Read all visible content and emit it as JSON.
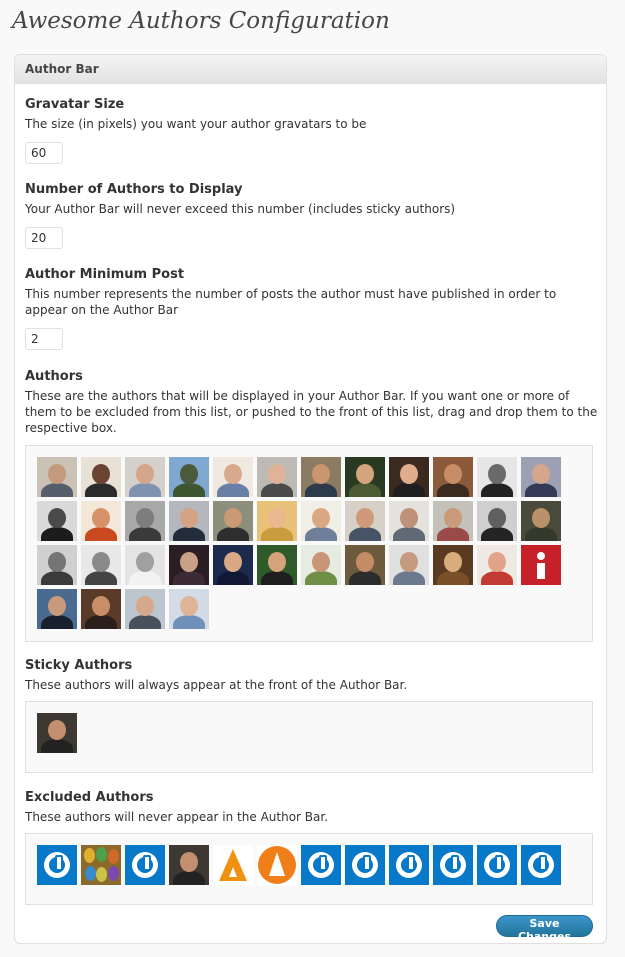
{
  "page": {
    "title": "Awesome Authors Configuration"
  },
  "section": {
    "header": "Author Bar"
  },
  "gravatar": {
    "title": "Gravatar Size",
    "description": "The size (in pixels) you want your author gravatars to be",
    "value": "60"
  },
  "num_authors": {
    "title": "Number of Authors to Display",
    "description": "Your Author Bar will never exceed this number (includes sticky authors)",
    "value": "20"
  },
  "min_post": {
    "title": "Author Minimum Post",
    "description": "This number represents the number of posts the author must have published in order to appear on the Author Bar",
    "value": "2"
  },
  "authors": {
    "title": "Authors",
    "description": "These are the authors that will be displayed in your Author Bar. If you want one or more of them to be excluded from this list, or pushed to the front of this list, drag and drop them to the respective box.",
    "avatars": [
      {
        "bg": "#c9c2b5",
        "skin": "#c49a7c",
        "shirt": "#555e6a"
      },
      {
        "bg": "#e7e1d6",
        "skin": "#6b4332",
        "shirt": "#2b2b2b"
      },
      {
        "bg": "#d4d0cb",
        "skin": "#d4a58a",
        "shirt": "#7f93b0"
      },
      {
        "bg": "#7fa7cf",
        "skin": "#4c5a3c",
        "shirt": "#3f5731"
      },
      {
        "bg": "#efe9e1",
        "skin": "#d8a98c",
        "shirt": "#6a7fa6"
      },
      {
        "bg": "#bdbab5",
        "skin": "#e0b29a",
        "shirt": "#4b4b4b"
      },
      {
        "bg": "#8c7b63",
        "skin": "#c9966f",
        "shirt": "#2c3a4b"
      },
      {
        "bg": "#2a3a22",
        "skin": "#d3a47e",
        "shirt": "#4c5b34"
      },
      {
        "bg": "#3b2a20",
        "skin": "#e0ad8c",
        "shirt": "#1f1f1f"
      },
      {
        "bg": "#8a5a3a",
        "skin": "#c88d67",
        "shirt": "#3a2a1f"
      },
      {
        "bg": "#e6e6e6",
        "skin": "#6a6a6a",
        "shirt": "#222222"
      },
      {
        "bg": "#9d9fb3",
        "skin": "#d4a68c",
        "shirt": "#333a55"
      },
      {
        "bg": "#d9d9d9",
        "skin": "#4a4a4a",
        "shirt": "#1c1c1c"
      },
      {
        "bg": "#f3e8d8",
        "skin": "#d89269",
        "shirt": "#c84a1e"
      },
      {
        "bg": "#a8a8a8",
        "skin": "#7d7d7d",
        "shirt": "#3a3a3a"
      },
      {
        "bg": "#b4b8bd",
        "skin": "#d3a383",
        "shirt": "#232c3a"
      },
      {
        "bg": "#8c8f7c",
        "skin": "#c99a73",
        "shirt": "#2e2e2e"
      },
      {
        "bg": "#e9c27a",
        "skin": "#eab78f",
        "shirt": "#c99c3e"
      },
      {
        "bg": "#f1eee6",
        "skin": "#d9a782",
        "shirt": "#6f7f99"
      },
      {
        "bg": "#d6d0c6",
        "skin": "#cf9a7a",
        "shirt": "#485465"
      },
      {
        "bg": "#e5e2de",
        "skin": "#c09179",
        "shirt": "#5f6a74"
      },
      {
        "bg": "#c4c1bb",
        "skin": "#c99b7b",
        "shirt": "#9b4a4a"
      },
      {
        "bg": "#cfcfcf",
        "skin": "#5f5f5f",
        "shirt": "#242424"
      },
      {
        "bg": "#4a4a3c",
        "skin": "#b9916a",
        "shirt": "#33392b"
      },
      {
        "bg": "#d0d0d0",
        "skin": "#747474",
        "shirt": "#3b3b3b"
      },
      {
        "bg": "#e8e8e8",
        "skin": "#8a8a8a",
        "shirt": "#444444"
      },
      {
        "bg": "#e4e4e4",
        "skin": "#a0a0a0",
        "shirt": "#f2f2f2"
      },
      {
        "bg": "#2b1d24",
        "skin": "#caa086",
        "shirt": "#3d2b33"
      },
      {
        "bg": "#1c2a4e",
        "skin": "#d8a887",
        "shirt": "#101833"
      },
      {
        "bg": "#2f5a2a",
        "skin": "#d5a27c",
        "shirt": "#1e1e1e"
      },
      {
        "bg": "#e7ece3",
        "skin": "#c89677",
        "shirt": "#6f8f47"
      },
      {
        "bg": "#6e5a3d",
        "skin": "#c48c65",
        "shirt": "#2c2c2c"
      },
      {
        "bg": "#e0e0e0",
        "skin": "#c59a7e",
        "shirt": "#6d7a8e"
      },
      {
        "bg": "#5a3b22",
        "skin": "#d8ac7d",
        "shirt": "#7a5028"
      },
      {
        "bg": "#eeeae3",
        "skin": "#e1a48a",
        "shirt": "#c13b32"
      },
      {
        "bg": "#3d4a35",
        "skin": "#c79773",
        "shirt": "#1c1c1c"
      },
      {
        "bg": "#4a6a8f",
        "skin": "#c69a7b",
        "shirt": "#17202c"
      },
      {
        "bg": "#5a3a28",
        "skin": "#c78e68",
        "shirt": "#2a1f1a"
      },
      {
        "bg": "#bcc6cf",
        "skin": "#d5a98b",
        "shirt": "#48525d"
      },
      {
        "bg": "#d2dbe6",
        "skin": "#e0b497",
        "shirt": "#6f90b8"
      }
    ],
    "special": {
      "index": 35,
      "type": "info"
    }
  },
  "sticky": {
    "title": "Sticky Authors",
    "description": "These authors will always appear at the front of the Author Bar.",
    "avatars": [
      {
        "bg": "#3e3832",
        "skin": "#c48f6e",
        "shirt": "#222222"
      }
    ]
  },
  "excluded": {
    "title": "Excluded Authors",
    "description": "These authors will never appear in the Author Bar.",
    "tiles": [
      "power",
      "faces",
      "power",
      "person",
      "a-triangle",
      "a-circle",
      "power",
      "power",
      "power",
      "power",
      "power",
      "power"
    ],
    "person": {
      "bg": "#3e3832",
      "skin": "#c48f6e",
      "shirt": "#222222"
    },
    "colors": {
      "power_blue": "#0878c9",
      "a_orange": "#f0910f"
    }
  },
  "actions": {
    "save_label": "Save Changes"
  }
}
